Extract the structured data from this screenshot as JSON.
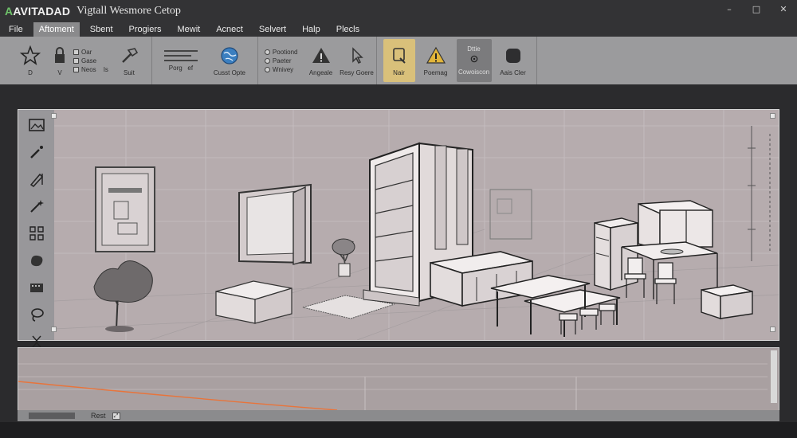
{
  "titlebar": {
    "logo_prefix": "A",
    "logo_rest": "AVITADAD",
    "title": "Vigtall Wesmore Cetop",
    "minimize_glyph": "–",
    "maximize_glyph": "□",
    "close_glyph": "✕"
  },
  "menu": {
    "items": [
      "File",
      "Aftoment",
      "Sbent",
      "Progiers",
      "Mewit",
      "Acnect",
      "Selvert",
      "Halp",
      "Plecls"
    ],
    "active_index": 1
  },
  "ribbon": {
    "star_label": "D",
    "lock_label": "V",
    "list1": [
      "Oar",
      "Gase",
      "Neos"
    ],
    "list1_label": "Is",
    "hammer_label": "Suit",
    "lines_label": "Porg",
    "lines_label2": "ef",
    "globe_label": "Cusst Opte",
    "list2": [
      "Pootiond",
      "Paeter",
      "Wnivey"
    ],
    "warning_label": "Angeale",
    "cursor_label": "Resy Goere",
    "layers_label": "Nair",
    "warning2_label": "Poemag",
    "selected_tool_top": "Dttie",
    "selected_tool_label": "Cowoiscon",
    "cube_label": "Aais Cler"
  },
  "statusbar": {
    "coord_text": "Rest"
  },
  "colors": {
    "ribbon_bg": "#9b9b9d",
    "viewport_bg": "#b6acae",
    "highlight": "#d9c07a",
    "timeline_curve": "#e8743b"
  }
}
